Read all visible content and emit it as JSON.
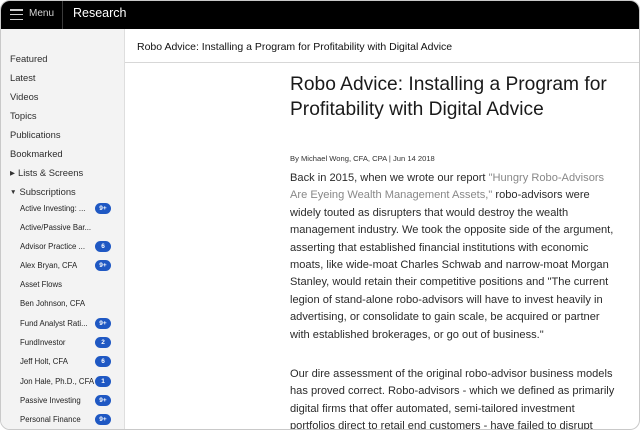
{
  "topbar": {
    "menu_label": "Menu",
    "section_title": "Research"
  },
  "sidebar": {
    "items": [
      {
        "label": "Featured"
      },
      {
        "label": "Latest"
      },
      {
        "label": "Videos"
      },
      {
        "label": "Topics"
      },
      {
        "label": "Publications"
      },
      {
        "label": "Bookmarked"
      },
      {
        "label": "Lists & Screens",
        "toggle": "collapsed"
      },
      {
        "label": "Subscriptions",
        "toggle": "expanded"
      }
    ],
    "subscriptions": [
      {
        "label": "Active Investing: ...",
        "badge": "9+"
      },
      {
        "label": "Active/Passive Bar...",
        "badge": ""
      },
      {
        "label": "Advisor Practice ...",
        "badge": "6"
      },
      {
        "label": "Alex Bryan, CFA",
        "badge": "9+"
      },
      {
        "label": "Asset Flows",
        "badge": ""
      },
      {
        "label": "Ben Johnson, CFA",
        "badge": ""
      },
      {
        "label": "Fund Analyst Rati...",
        "badge": "9+"
      },
      {
        "label": "FundInvestor",
        "badge": "2"
      },
      {
        "label": "Jeff Holt, CFA",
        "badge": "6"
      },
      {
        "label": "Jon Hale, Ph.D., CFA",
        "badge": "1"
      },
      {
        "label": "Passive Investing",
        "badge": "9+"
      },
      {
        "label": "Personal Finance",
        "badge": "9+"
      }
    ]
  },
  "content": {
    "header_title": "Robo Advice: Installing a Program for Profitability with Digital Advice",
    "title_line1": "Robo Advice: Installing a Program for",
    "title_line2": "Profitability with Digital Advice",
    "byline": "By Michael Wong, CFA, CPA | Jun 14 2018",
    "p1_before": "Back in 2015, when we wrote our report ",
    "p1_link": "\"Hungry Robo-Advisors Are Eyeing Wealth Management Assets,\"",
    "p1_after": " robo-advisors were widely touted as disrupters that would destroy the wealth management industry. We took the opposite side of the argument, asserting that established financial institutions with economic moats, like wide-moat Charles Schwab and narrow-moat Morgan Stanley, would retain their competitive positions and \"The current legion of stand-alone robo-advisors will have to invest heavily in advertising, or consolidate to gain scale, be acquired or partner with established brokerages, or go out of business.\"",
    "p2": "Our dire assessment of the original robo-advisor business models has proved correct. Robo-advisors - which we defined as primarily digital firms that offer automated, semi-tailored investment portfolios direct to retail end customers - have failed to disrupt"
  },
  "colors": {
    "topbar_bg": "#000000",
    "sidebar_bg": "#f3f3f3",
    "badge_bg": "#1f58c3",
    "link_text": "#888888"
  },
  "icons": {
    "menu": "hamburger-icon",
    "collapsed": "triangle-right-icon",
    "expanded": "triangle-down-icon"
  }
}
